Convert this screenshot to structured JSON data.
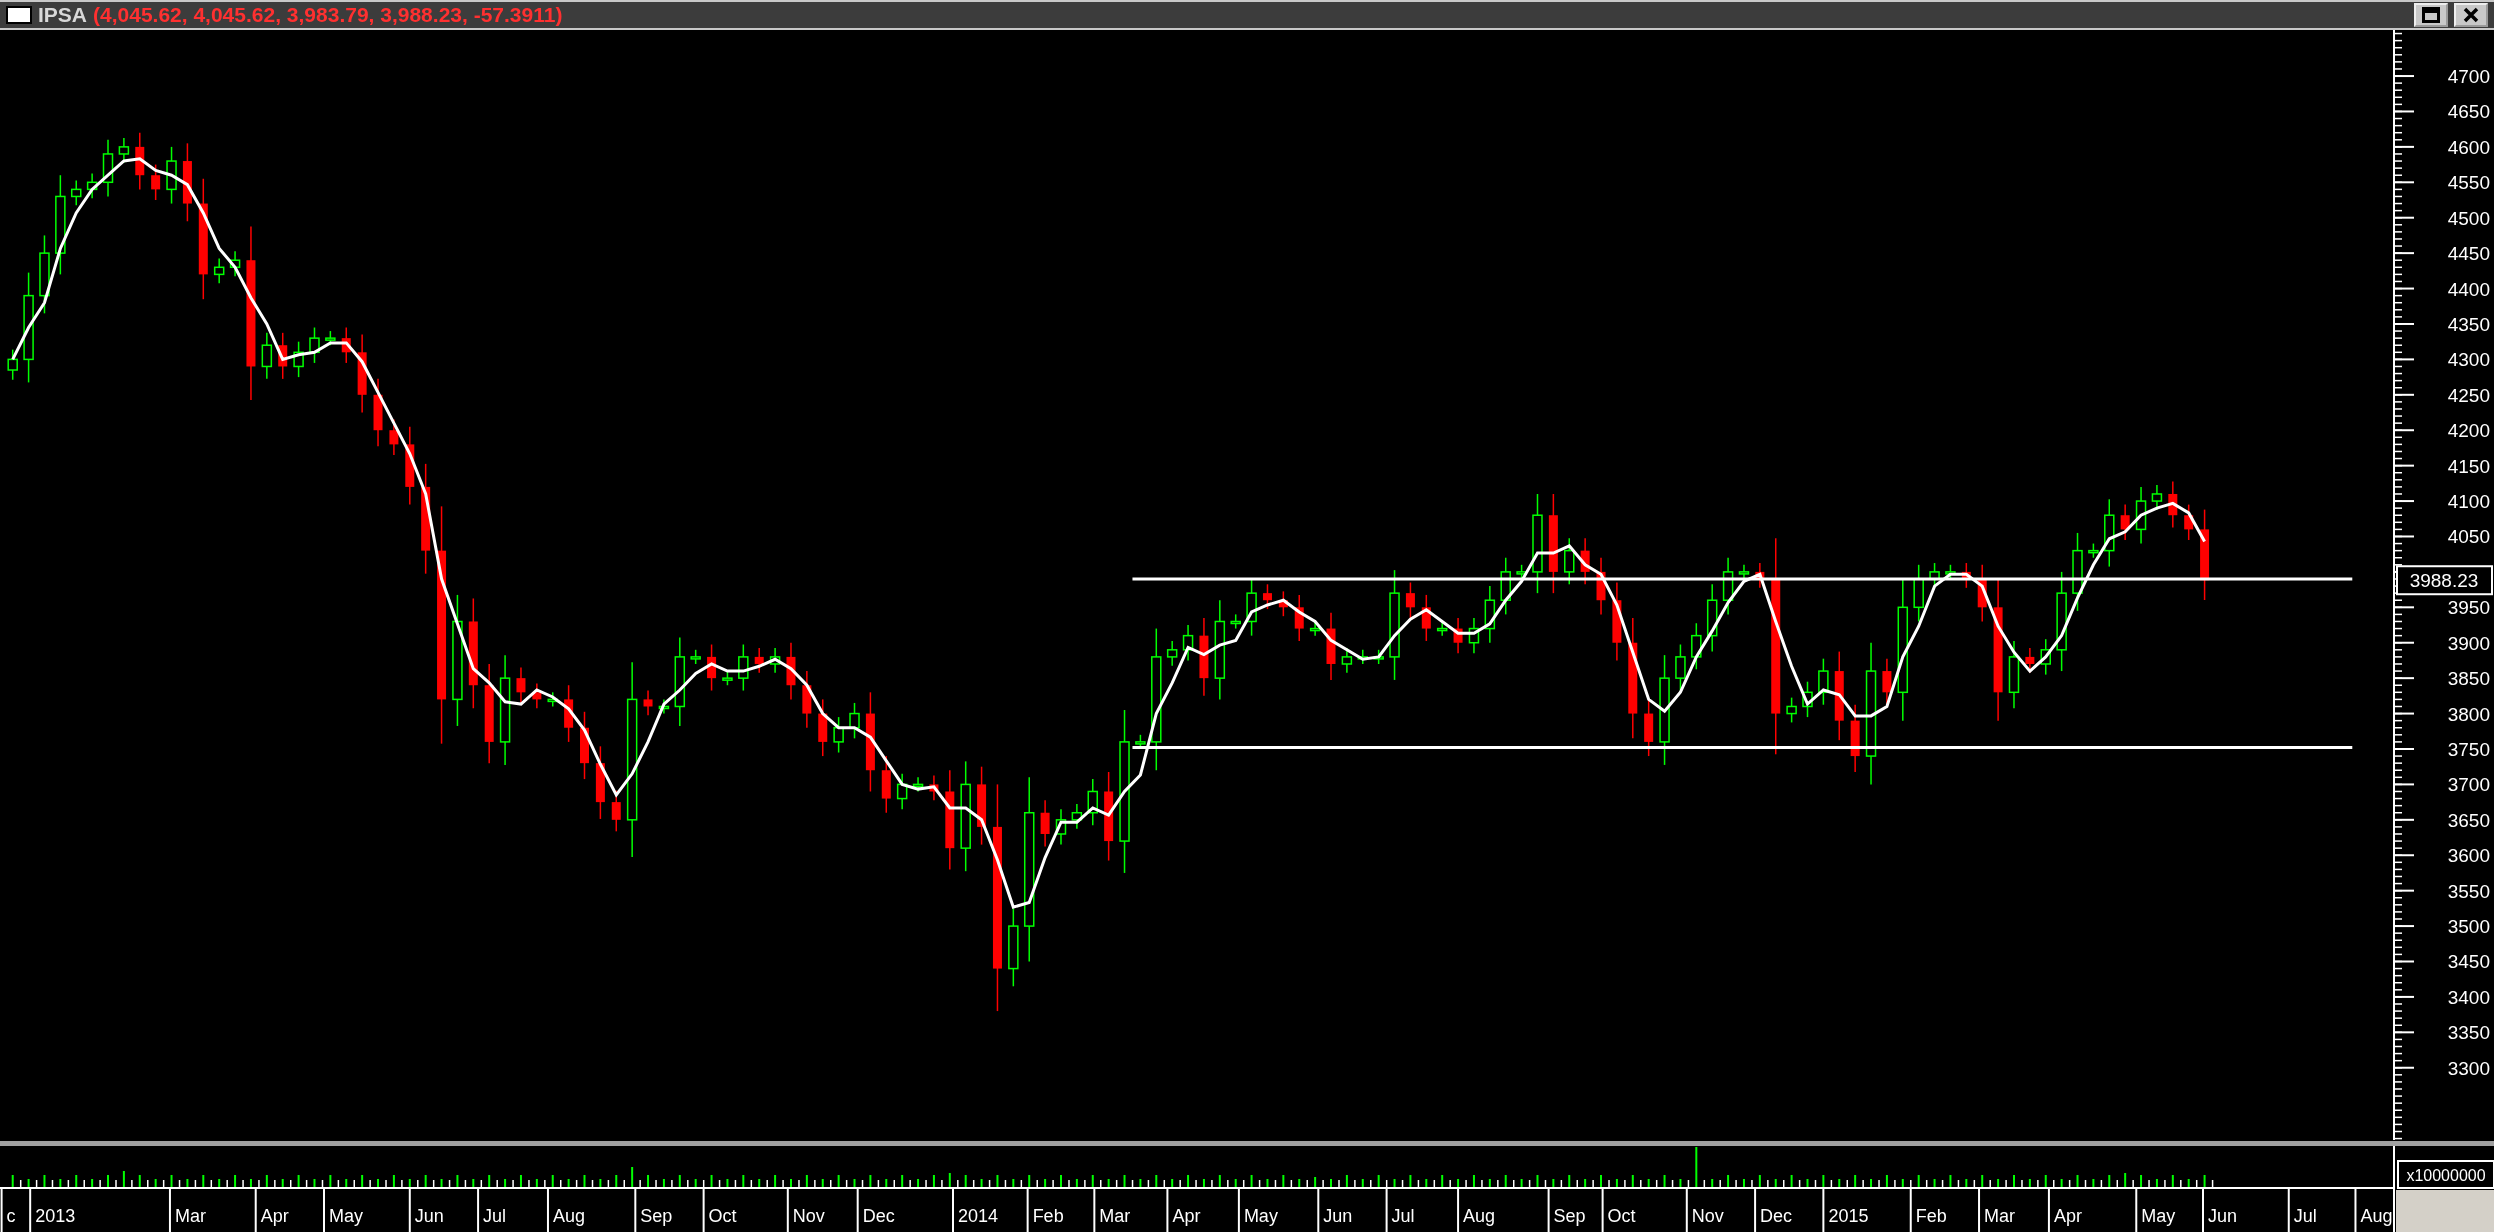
{
  "window": {
    "title": "IPSA",
    "quote": "(4,045.62, 4,045.62, 3,983.79, 3,988.23, -57.3911)"
  },
  "chart": {
    "last_price_label": "3988.23",
    "volume_scale_label": "x10000000",
    "price_axis_labels": [
      "4700",
      "4650",
      "4600",
      "4550",
      "4500",
      "4450",
      "4400",
      "4350",
      "4300",
      "4250",
      "4200",
      "4150",
      "4100",
      "4050",
      "3950",
      "3900",
      "3850",
      "3800",
      "3750",
      "3700",
      "3650",
      "3600",
      "3550",
      "3500",
      "3450",
      "3400",
      "3350",
      "3300"
    ],
    "month_labels": [
      "c",
      "2013",
      "Mar",
      "Apr",
      "May",
      "Jun",
      "Jul",
      "Aug",
      "Sep",
      "Oct",
      "Nov",
      "Dec",
      "2014",
      "Feb",
      "Mar",
      "Apr",
      "May",
      "Jun",
      "Jul",
      "Aug",
      "Sep",
      "Oct",
      "Nov",
      "Dec",
      "2015",
      "Feb",
      "Mar",
      "Apr",
      "May",
      "Jun",
      "Jul",
      "Aug"
    ]
  }
}
